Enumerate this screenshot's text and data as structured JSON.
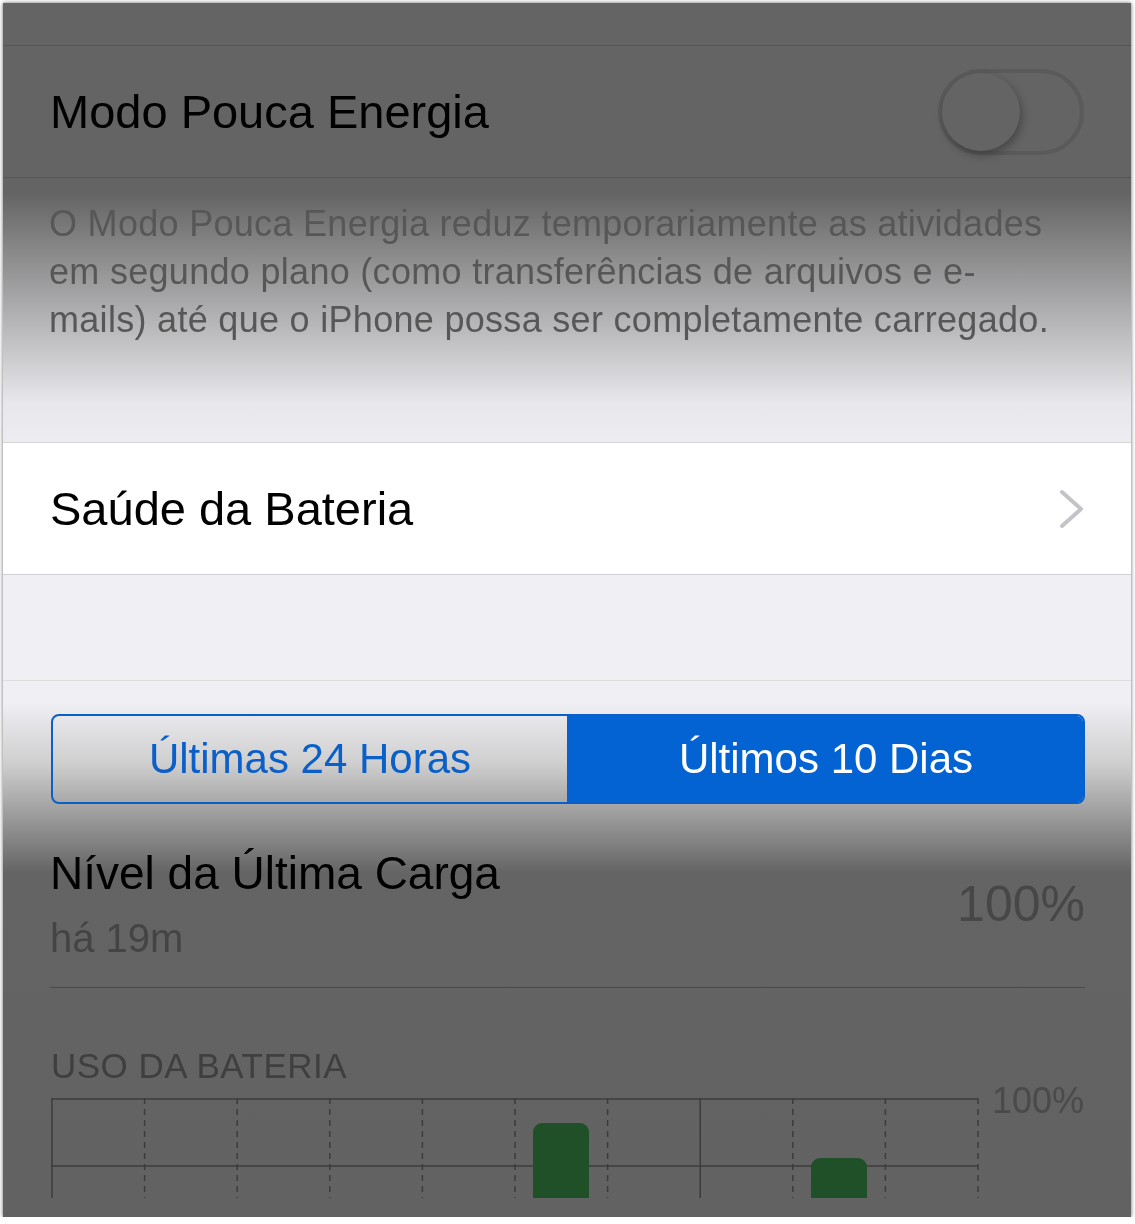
{
  "low_power": {
    "label": "Modo Pouca Energia",
    "on": false
  },
  "description": "O Modo Pouca Energia reduz temporariamente as atividades em segundo plano (como transferências de arquivos e e-mails) até que o iPhone possa ser completamente carregado.",
  "battery_health": {
    "label": "Saúde da Bateria"
  },
  "segments": [
    {
      "label": "Últimas 24 Horas",
      "selected": false
    },
    {
      "label": "Últimos 10 Dias",
      "selected": true
    }
  ],
  "last_charge": {
    "title": "Nível da Última Carga",
    "time": "há 19m",
    "value": "100%"
  },
  "usage": {
    "title": "USO DA BATERIA",
    "scale_label": "100%"
  }
}
